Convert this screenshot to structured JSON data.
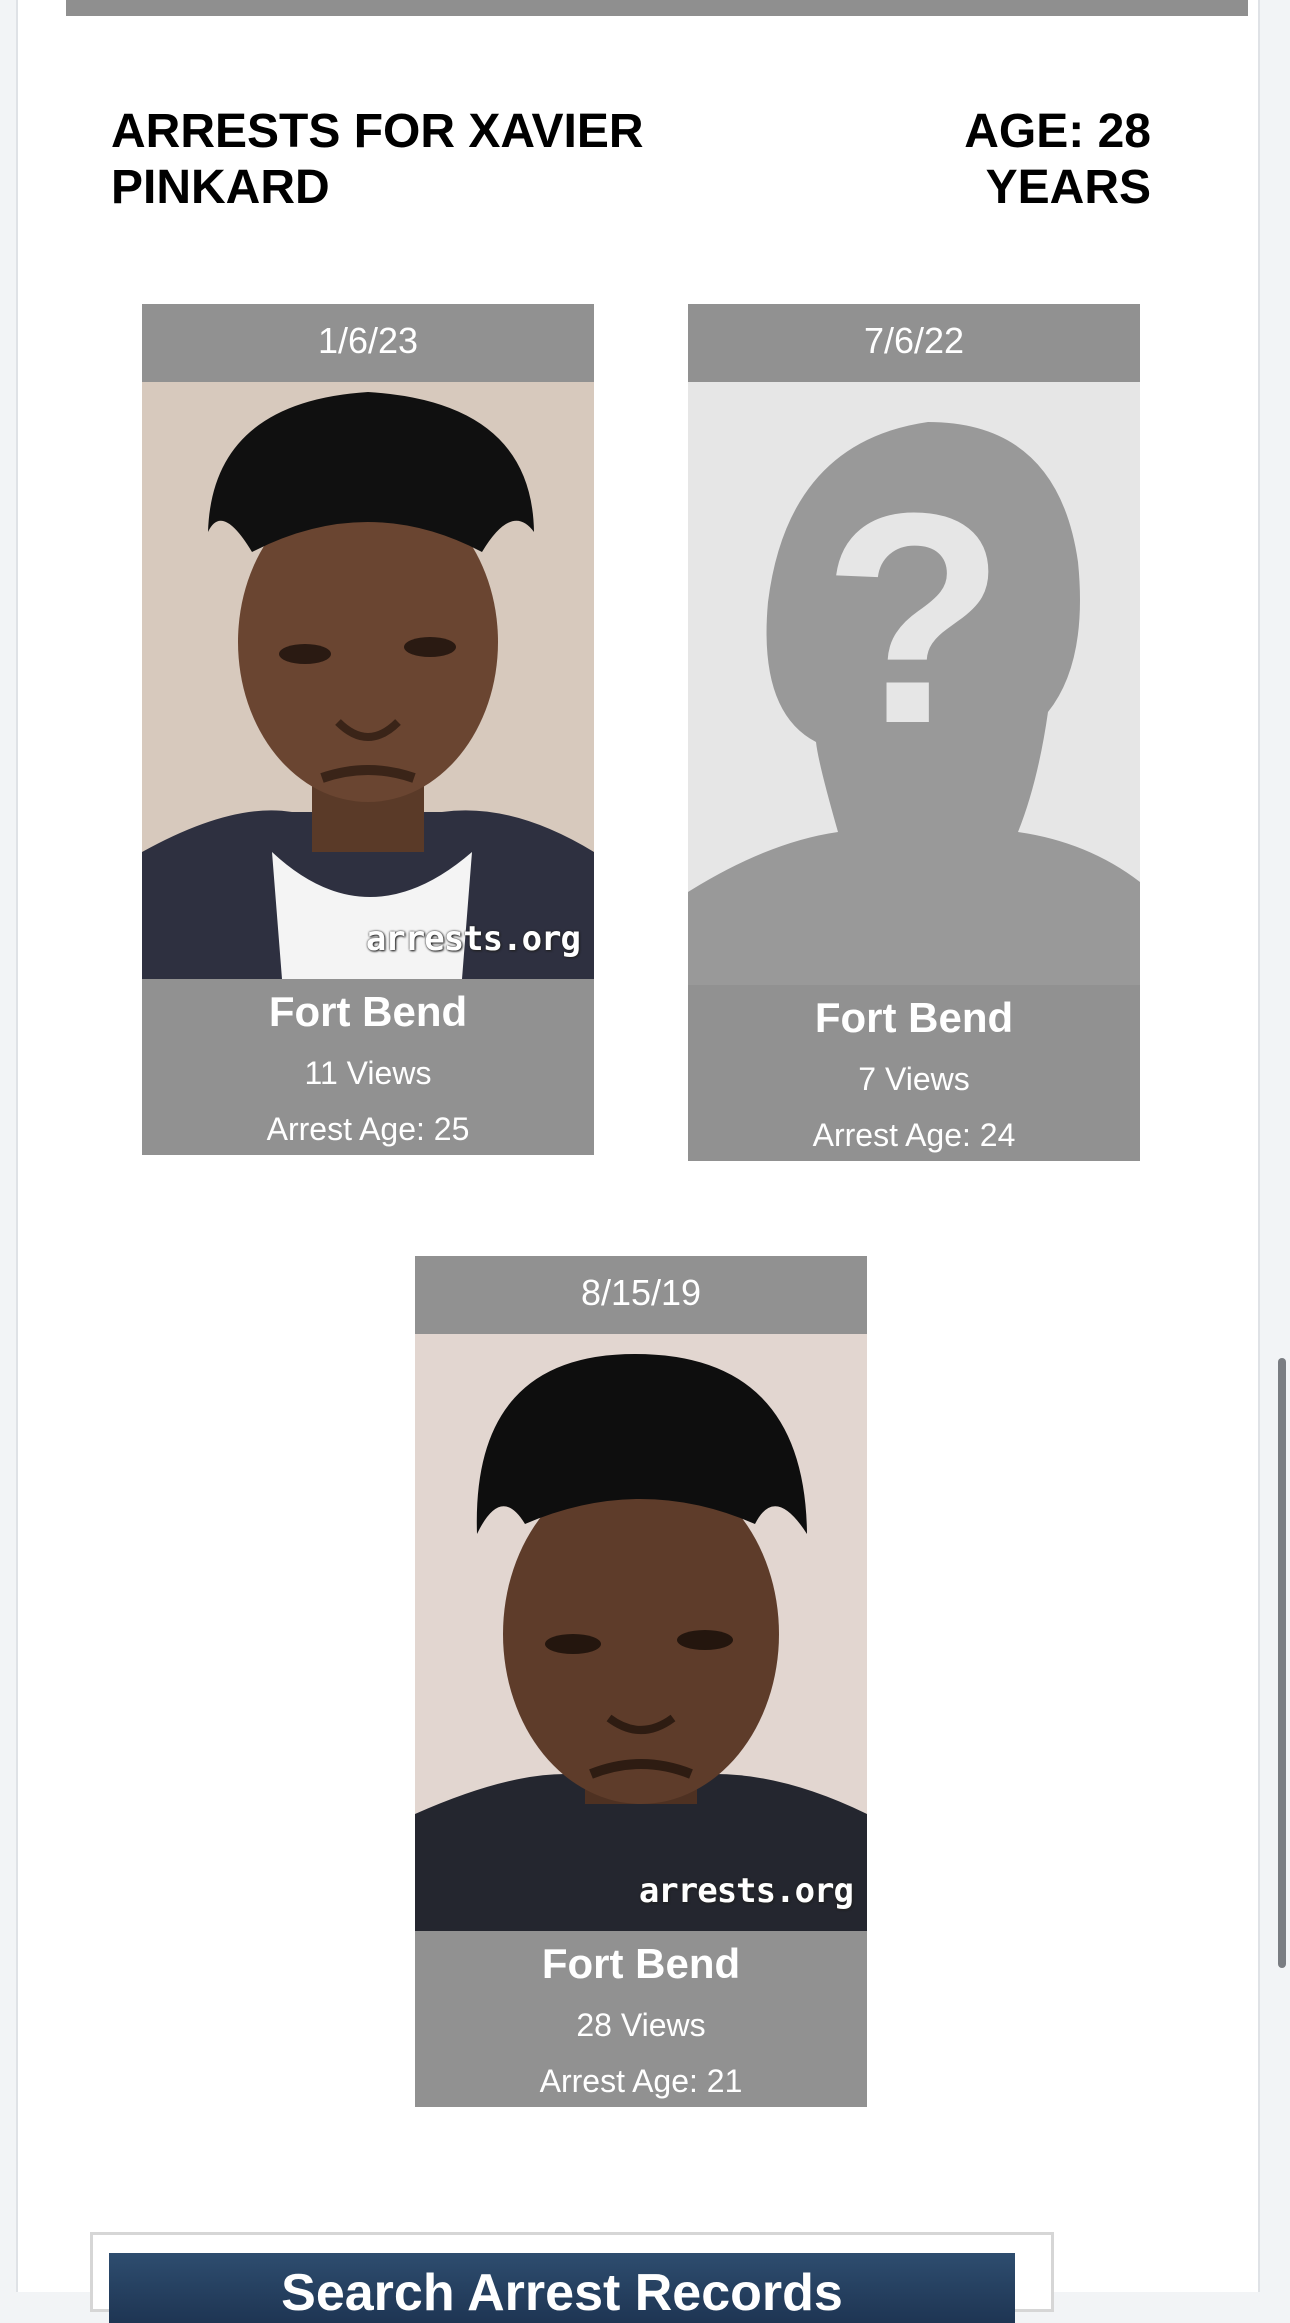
{
  "header": {
    "title": "ARRESTS FOR XAVIER PINKARD",
    "age": "AGE: 28 YEARS"
  },
  "arrests": [
    {
      "date": "1/6/23",
      "county": "Fort Bend",
      "views": "11 Views",
      "arrest_age": "Arrest Age: 25",
      "watermark": "arrests.org",
      "photo": "mugshot"
    },
    {
      "date": "7/6/22",
      "county": "Fort Bend",
      "views": "7 Views",
      "arrest_age": "Arrest Age: 24",
      "photo": "placeholder-question-silhouette"
    },
    {
      "date": "8/15/19",
      "county": "Fort Bend",
      "views": "28 Views",
      "arrest_age": "Arrest Age: 21",
      "watermark": "arrests.org",
      "photo": "mugshot"
    }
  ],
  "search": {
    "banner": "Search Arrest Records"
  },
  "colors": {
    "card_bg": "#919191",
    "banner_bg": "#2e4d6f"
  }
}
